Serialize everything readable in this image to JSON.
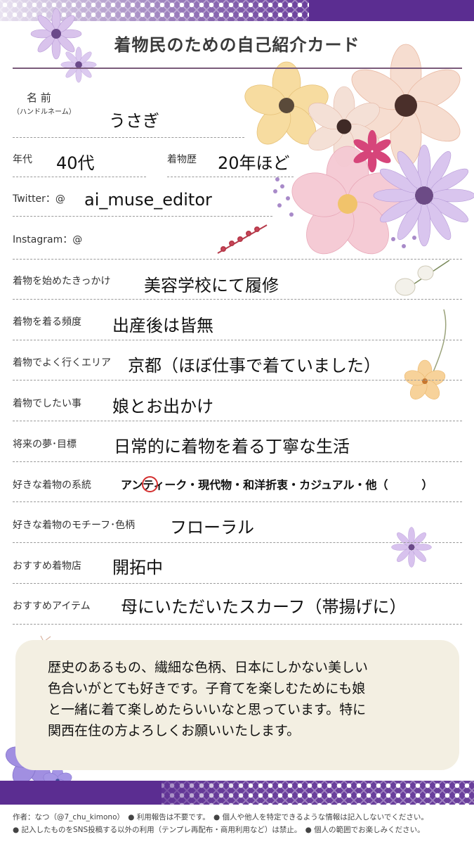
{
  "title": "着物民のための自己紹介カード",
  "fields": {
    "name": {
      "label": "名 前",
      "sublabel": "（ハンドルネーム）",
      "value": "うさぎ"
    },
    "age": {
      "label": "年代",
      "value": "40代"
    },
    "kimono_history": {
      "label": "着物歴",
      "value": "20年ほど"
    },
    "twitter": {
      "label": "Twitter：@",
      "value": "ai_muse_editor"
    },
    "instagram": {
      "label": "Instagram：@",
      "value": ""
    },
    "trigger": {
      "label": "着物を始めたきっかけ",
      "value": "美容学校にて履修"
    },
    "frequency": {
      "label": "着物を着る頻度",
      "value": "出産後は皆無"
    },
    "area": {
      "label": "着物でよく行くエリア",
      "value": "京都（ほぼ仕事で着ていました）"
    },
    "want_to_do": {
      "label": "着物でしたい事",
      "value": "娘とお出かけ"
    },
    "dream": {
      "label": "将来の夢･目標",
      "value": "日常的に着物を着る丁寧な生活"
    },
    "style": {
      "label": "好きな着物の系統",
      "value": "アンティーク・現代物・和洋折衷・カジュアル・他（　　　）",
      "circled": "ティ"
    },
    "motif": {
      "label": "好きな着物のモチーフ･色柄",
      "value": "フローラル"
    },
    "shop": {
      "label": "おすすめ着物店",
      "value": "開拓中"
    },
    "item": {
      "label": "おすすめアイテム",
      "value": "母にいただいたスカーフ（帯揚げに）"
    }
  },
  "message": {
    "lines": [
      "歴史のあるもの、繊細な色柄、日本にしかない美しい",
      "色合いがとても好きです。子育てを楽しむためにも娘",
      "と一緒に着て楽しめたらいいなと思っています。特に",
      "関西在住の方よろしくお願いいたします。"
    ]
  },
  "footer": {
    "line1": "作者：なつ（@7_chu_kimono）　● 利用報告は不要です。　● 個人や他人を特定できるような情報は記入しないでください。",
    "line2": "● 記入したものをSNS投稿する以外の利用（テンプレ再配布・商用利用など）は禁止。　● 個人の範囲でお楽しみください。"
  },
  "colors": {
    "band": "#5b2d91",
    "accent_circle": "#d32f2f",
    "message_bg": "#f3efe2"
  },
  "decor": [
    "flower-bouquet",
    "small-flowers"
  ]
}
